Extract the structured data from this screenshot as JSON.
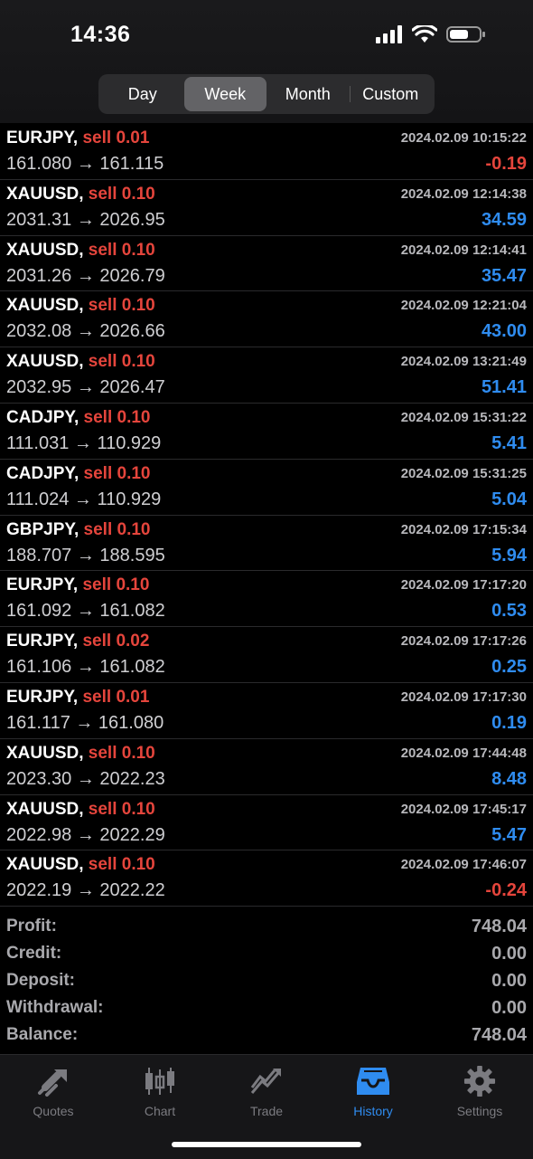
{
  "status": {
    "time": "14:36"
  },
  "periods": [
    "Day",
    "Week",
    "Month",
    "Custom"
  ],
  "active_period": "Week",
  "deals": [
    {
      "symbol": "EURJPY,",
      "side": "sell 0.01",
      "datetime": "2024.02.09 10:15:22",
      "prices": "161.080 → 161.115",
      "profit": "-0.19",
      "sign": "neg"
    },
    {
      "symbol": "XAUUSD,",
      "side": "sell 0.10",
      "datetime": "2024.02.09 12:14:38",
      "prices": "2031.31 → 2026.95",
      "profit": "34.59",
      "sign": "pos"
    },
    {
      "symbol": "XAUUSD,",
      "side": "sell 0.10",
      "datetime": "2024.02.09 12:14:41",
      "prices": "2031.26 → 2026.79",
      "profit": "35.47",
      "sign": "pos"
    },
    {
      "symbol": "XAUUSD,",
      "side": "sell 0.10",
      "datetime": "2024.02.09 12:21:04",
      "prices": "2032.08 → 2026.66",
      "profit": "43.00",
      "sign": "pos"
    },
    {
      "symbol": "XAUUSD,",
      "side": "sell 0.10",
      "datetime": "2024.02.09 13:21:49",
      "prices": "2032.95 → 2026.47",
      "profit": "51.41",
      "sign": "pos"
    },
    {
      "symbol": "CADJPY,",
      "side": "sell 0.10",
      "datetime": "2024.02.09 15:31:22",
      "prices": "111.031 → 110.929",
      "profit": "5.41",
      "sign": "pos"
    },
    {
      "symbol": "CADJPY,",
      "side": "sell 0.10",
      "datetime": "2024.02.09 15:31:25",
      "prices": "111.024 → 110.929",
      "profit": "5.04",
      "sign": "pos"
    },
    {
      "symbol": "GBPJPY,",
      "side": "sell 0.10",
      "datetime": "2024.02.09 17:15:34",
      "prices": "188.707 → 188.595",
      "profit": "5.94",
      "sign": "pos"
    },
    {
      "symbol": "EURJPY,",
      "side": "sell 0.10",
      "datetime": "2024.02.09 17:17:20",
      "prices": "161.092 → 161.082",
      "profit": "0.53",
      "sign": "pos"
    },
    {
      "symbol": "EURJPY,",
      "side": "sell 0.02",
      "datetime": "2024.02.09 17:17:26",
      "prices": "161.106 → 161.082",
      "profit": "0.25",
      "sign": "pos"
    },
    {
      "symbol": "EURJPY,",
      "side": "sell 0.01",
      "datetime": "2024.02.09 17:17:30",
      "prices": "161.117 → 161.080",
      "profit": "0.19",
      "sign": "pos"
    },
    {
      "symbol": "XAUUSD,",
      "side": "sell 0.10",
      "datetime": "2024.02.09 17:44:48",
      "prices": "2023.30 → 2022.23",
      "profit": "8.48",
      "sign": "pos"
    },
    {
      "symbol": "XAUUSD,",
      "side": "sell 0.10",
      "datetime": "2024.02.09 17:45:17",
      "prices": "2022.98 → 2022.29",
      "profit": "5.47",
      "sign": "pos"
    },
    {
      "symbol": "XAUUSD,",
      "side": "sell 0.10",
      "datetime": "2024.02.09 17:46:07",
      "prices": "2022.19 → 2022.22",
      "profit": "-0.24",
      "sign": "neg"
    }
  ],
  "summary": [
    {
      "label": "Profit:",
      "value": "748.04"
    },
    {
      "label": "Credit:",
      "value": "0.00"
    },
    {
      "label": "Deposit:",
      "value": "0.00"
    },
    {
      "label": "Withdrawal:",
      "value": "0.00"
    },
    {
      "label": "Balance:",
      "value": "748.04"
    }
  ],
  "tabs": [
    {
      "label": "Quotes",
      "icon": "quotes-icon"
    },
    {
      "label": "Chart",
      "icon": "chart-icon"
    },
    {
      "label": "Trade",
      "icon": "trade-icon"
    },
    {
      "label": "History",
      "icon": "history-icon"
    },
    {
      "label": "Settings",
      "icon": "settings-icon"
    }
  ],
  "active_tab": "History",
  "colors": {
    "sell": "#e5453c",
    "profit_pos": "#2f8cf0",
    "profit_neg": "#e5453c",
    "accent": "#2f8cf0"
  }
}
